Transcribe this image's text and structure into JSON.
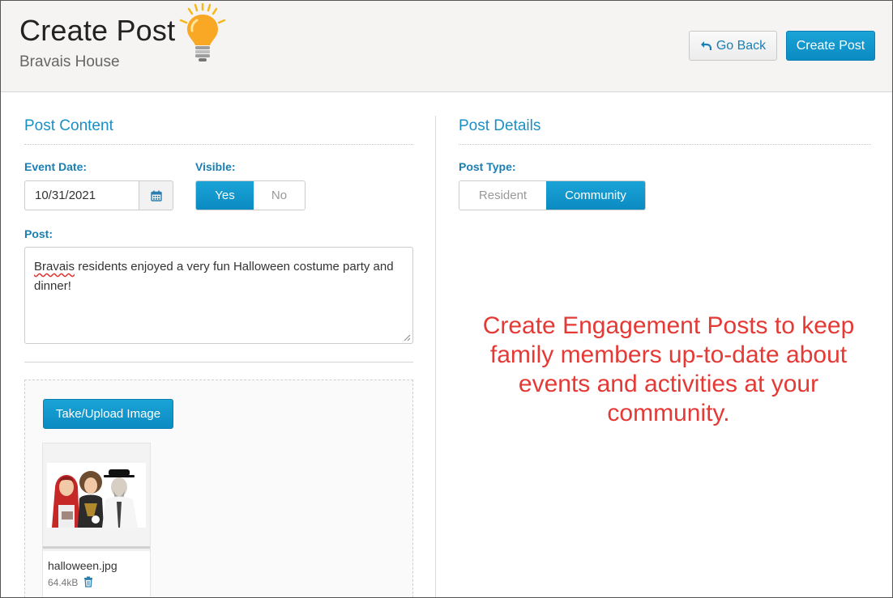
{
  "header": {
    "title": "Create Post",
    "subtitle": "Bravais House",
    "go_back_label": "Go Back",
    "create_post_label": "Create Post"
  },
  "post_content": {
    "section_title": "Post Content",
    "event_date_label": "Event Date:",
    "event_date_value": "10/31/2021",
    "visible_label": "Visible:",
    "visible_options": [
      "Yes",
      "No"
    ],
    "visible_selected": "Yes",
    "post_label": "Post:",
    "post_text_first_word": "Bravais",
    "post_text_rest": " residents enjoyed a very fun Halloween costume party and dinner!",
    "upload_button_label": "Take/Upload Image",
    "attachment": {
      "file_name": "halloween.jpg",
      "file_size": "64.4kB"
    }
  },
  "post_details": {
    "section_title": "Post Details",
    "post_type_label": "Post Type:",
    "post_type_options": [
      "Resident",
      "Community"
    ],
    "post_type_selected": "Community"
  },
  "callout_text": "Create Engagement Posts to keep family members up-to-date about events and activities at your community.",
  "colors": {
    "accent": "#1a8fc4",
    "button_primary": "#0a8bc2",
    "header_bg": "#f6f4f3",
    "callout": "#e53935"
  },
  "icons": [
    "lightbulb-icon",
    "undo-arrow-icon",
    "calendar-icon",
    "trash-icon",
    "resize-grip-icon"
  ]
}
